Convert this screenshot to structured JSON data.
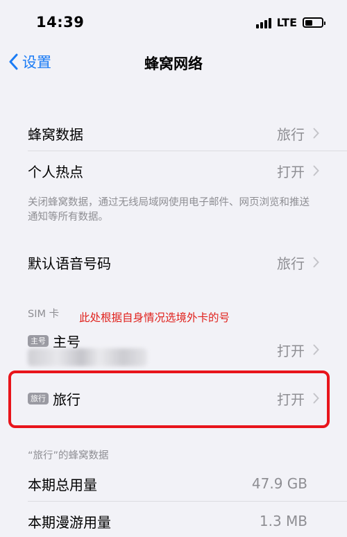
{
  "status_bar": {
    "time": "14:39",
    "network": "LTE",
    "icons": [
      "signal-icon",
      "battery-icon"
    ]
  },
  "nav": {
    "back_label": "设置",
    "title": "蜂窝网络",
    "icons": [
      "chevron-left-icon"
    ]
  },
  "rows": {
    "cellular_data": {
      "label": "蜂窝数据",
      "value": "旅行"
    },
    "hotspot": {
      "label": "个人热点",
      "value": "打开"
    },
    "default_voice": {
      "label": "默认语音号码",
      "value": "旅行"
    }
  },
  "footnote": "关闭蜂窝数据，通过无线局域网使用电子邮件、网页浏览和推送通知等所有数据。",
  "sim_section": {
    "header": "SIM 卡",
    "annotation": "此处根据自身情况选境外卡的号",
    "primary": {
      "tag": "主号",
      "label": "主号",
      "value": "打开"
    },
    "travel": {
      "tag": "旅行",
      "label": "旅行",
      "value": "打开"
    }
  },
  "usage_section": {
    "header": "“旅行”的蜂窝数据",
    "total": {
      "label": "本期总用量",
      "value": "47.9 GB"
    },
    "roaming": {
      "label": "本期漫游用量",
      "value": "1.3 MB"
    }
  },
  "colors": {
    "accent": "#1a7bf5",
    "annotation_red": "#e0201b",
    "secondary_text": "#8e8e93",
    "background": "#f2f2f7"
  }
}
